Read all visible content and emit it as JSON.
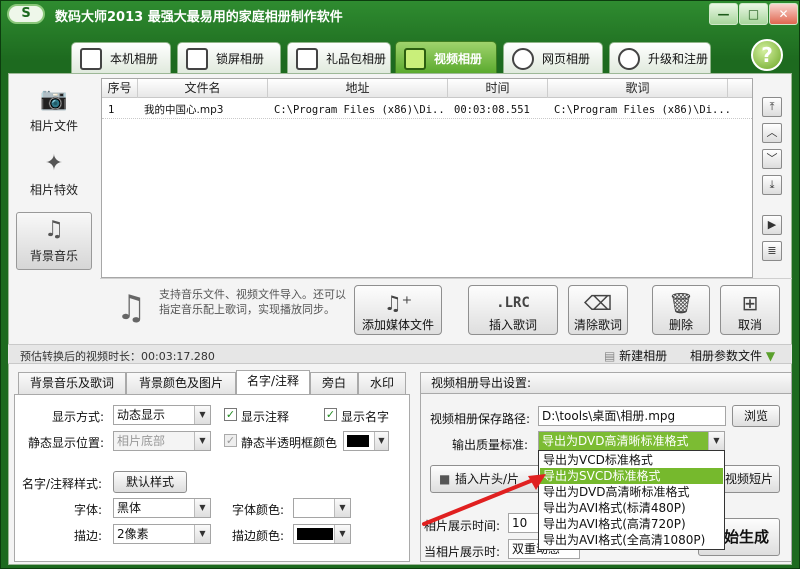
{
  "app": {
    "logo_text": "S",
    "title": "数码大师2013   最强大最易用的家庭相册制作软件"
  },
  "window_buttons": {
    "min": "—",
    "max": "□",
    "close": "✕"
  },
  "main_tabs": [
    {
      "label": "本机相册",
      "icon": "person-frame-icon"
    },
    {
      "label": "锁屏相册",
      "icon": "monitor-icon"
    },
    {
      "label": "礼品包相册",
      "icon": "gift-icon"
    },
    {
      "label": "视频相册",
      "icon": "film-icon",
      "active": true
    },
    {
      "label": "网页相册",
      "icon": "ie-icon"
    },
    {
      "label": "升级和注册",
      "icon": "globe-icon"
    }
  ],
  "help": "?",
  "sidebar": {
    "items": [
      {
        "label": "相片文件",
        "icon": "camera-icon",
        "glyph": "📷"
      },
      {
        "label": "相片特效",
        "icon": "sparkle-icon",
        "glyph": "✦"
      },
      {
        "label": "背景音乐",
        "icon": "music-icon",
        "glyph": "♫",
        "active": true
      }
    ]
  },
  "list": {
    "columns": [
      "序号",
      "文件名",
      "地址",
      "时间",
      "歌词"
    ],
    "rows": [
      {
        "index": "1",
        "filename": "我的中国心.mp3",
        "path": "C:\\Program Files (x86)\\Di...",
        "time": "00:03:08.551",
        "lyrics": "C:\\Program Files (x86)\\Di..."
      }
    ]
  },
  "scroll_buttons": [
    "⤒",
    "︿",
    "﹀",
    "⤓",
    "▶",
    "≣"
  ],
  "actions": {
    "hint": "支持音乐文件、视频文件导入。还可以指定音乐配上歌词，实现播放同步。",
    "buttons": [
      {
        "label": "添加媒体文件",
        "icon": "add-music-icon",
        "glyph": "♫⁺"
      },
      {
        "label": "插入歌词",
        "icon": "lrc-icon",
        "glyph": ".LRC"
      },
      {
        "label": "清除歌词",
        "icon": "eraser-icon",
        "glyph": "⌫"
      },
      {
        "label": "删除",
        "icon": "trash-icon",
        "glyph": "🗑"
      },
      {
        "label": "取消",
        "icon": "grid-icon",
        "glyph": "⊞"
      }
    ]
  },
  "status": {
    "estimate": "预估转换后的视频时长：00:03:17.280",
    "new_album": "新建相册",
    "param_file": "相册参数文件"
  },
  "sub_tabs": [
    {
      "label": "背景音乐及歌词"
    },
    {
      "label": "背景颜色及图片"
    },
    {
      "label": "名字/注释",
      "active": true
    },
    {
      "label": "旁白"
    },
    {
      "label": "水印"
    }
  ],
  "name_panel": {
    "display_mode_label": "显示方式:",
    "display_mode_value": "动态显示",
    "show_note_label": "显示注释",
    "show_name_label": "显示名字",
    "static_pos_label": "静态显示位置:",
    "static_pos_value": "相片底部",
    "semi_transparent_label": "静态半透明框颜色",
    "style_label": "名字/注释样式:",
    "default_style_button": "默认样式",
    "font_label": "字体:",
    "font_value": "黑体",
    "font_color_label": "字体颜色:",
    "stroke_label": "描边:",
    "stroke_value": "2像素",
    "stroke_color_label": "描边颜色:"
  },
  "export_panel": {
    "title": "视频相册导出设置:",
    "save_path_label": "视频相册保存路径:",
    "save_path_value": "D:\\tools\\桌面\\相册.mpg",
    "browse_button": "浏览",
    "quality_label": "输出质量标准:",
    "quality_value": "导出为DVD高清晰标准格式",
    "insert_clip_button": "插入片头/片",
    "video_clip_button": "视频短片",
    "display_time_label": "相片展示时间:",
    "display_time_value": "10",
    "current_display_label": "当相片展示时:",
    "current_display_value": "双重动感",
    "generate_button": "开始生成",
    "quality_options": [
      "导出为VCD标准格式",
      "导出为SVCD标准格式",
      "导出为DVD高清晰标准格式",
      "导出为AVI格式(标清480P)",
      "导出为AVI格式(高清720P)",
      "导出为AVI格式(全高清1080P)"
    ],
    "highlighted_option": 1
  },
  "colors": {
    "accent": "#76b92d",
    "frame": "#1d6a1f",
    "annotation_arrow": "#e02020"
  }
}
